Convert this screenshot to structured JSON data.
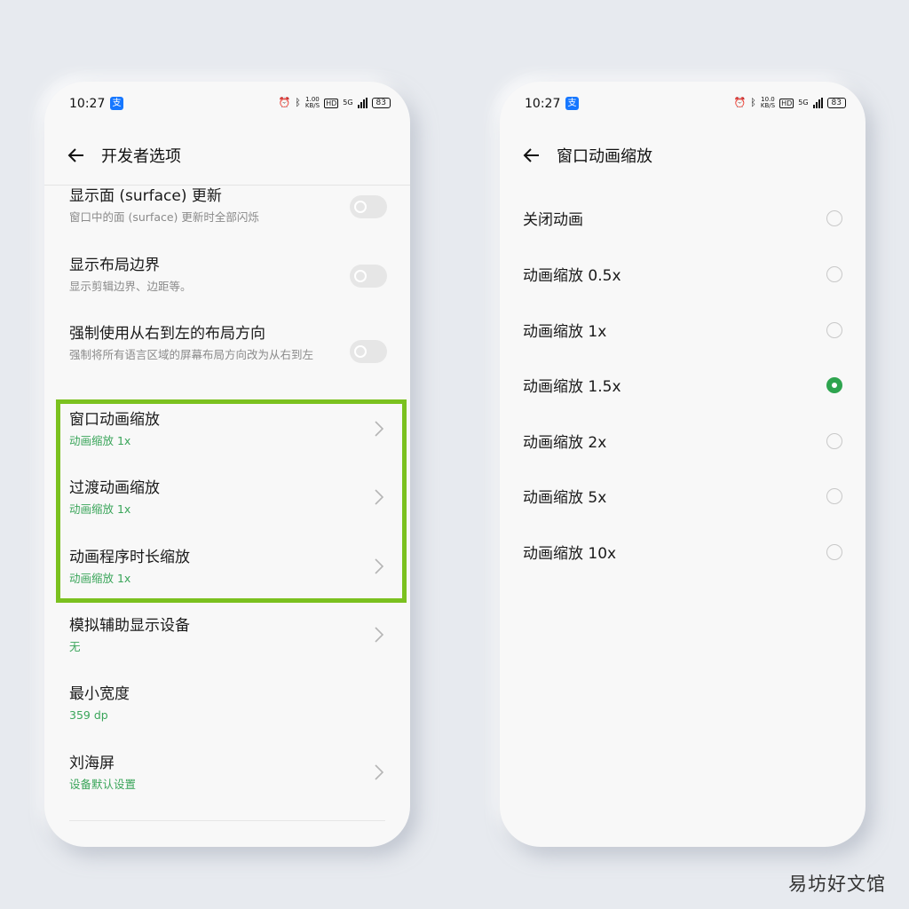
{
  "status": {
    "time": "10:27",
    "app_badge": "支",
    "speed_top": "1.00",
    "speed_bottom": "KB/S",
    "hd": "HD",
    "net": "5G",
    "battery": "83"
  },
  "status_right": {
    "speed_top": "10.0",
    "speed_bottom": "KB/S",
    "battery": "83"
  },
  "left": {
    "title": "开发者选项",
    "rows": [
      {
        "title": "显示面 (surface) 更新",
        "sub": "窗口中的面 (surface) 更新时全部闪烁"
      },
      {
        "title": "显示布局边界",
        "sub": "显示剪辑边界、边距等。"
      },
      {
        "title": "强制使用从右到左的布局方向",
        "sub": "强制将所有语言区域的屏幕布局方向改为从右到左"
      },
      {
        "title": "窗口动画缩放",
        "sub": "动画缩放 1x"
      },
      {
        "title": "过渡动画缩放",
        "sub": "动画缩放 1x"
      },
      {
        "title": "动画程序时长缩放",
        "sub": "动画缩放 1x"
      },
      {
        "title": "模拟辅助显示设备",
        "sub": "无"
      },
      {
        "title": "最小宽度",
        "sub": "359 dp"
      },
      {
        "title": "刘海屏",
        "sub": "设备默认设置"
      }
    ]
  },
  "right": {
    "title": "窗口动画缩放",
    "options": [
      {
        "label": "关闭动画",
        "selected": false
      },
      {
        "label": "动画缩放 0.5x",
        "selected": false
      },
      {
        "label": "动画缩放 1x",
        "selected": false
      },
      {
        "label": "动画缩放 1.5x",
        "selected": true
      },
      {
        "label": "动画缩放 2x",
        "selected": false
      },
      {
        "label": "动画缩放 5x",
        "selected": false
      },
      {
        "label": "动画缩放 10x",
        "selected": false
      }
    ]
  },
  "colors": {
    "accent_green": "#2ea44f",
    "highlight_border": "#7bc11f",
    "subtitle_green": "#3aa55a"
  },
  "watermark": "易坊好文馆"
}
